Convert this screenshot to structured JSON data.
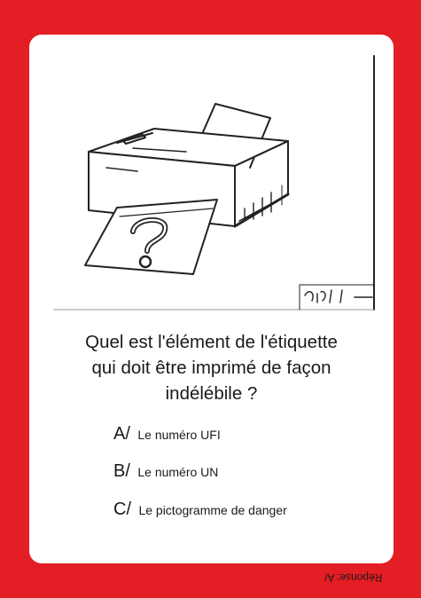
{
  "card": {
    "illustration": {
      "icon": "printer-question-icon",
      "signature": "ลุงวิ ๆ"
    },
    "question_lines": [
      "Quel est l'élément de l'étiquette",
      "qui doit être imprimé de façon",
      "indélébile ?"
    ],
    "answers": [
      {
        "letter": "A/",
        "text": "Le numéro UFI"
      },
      {
        "letter": "B/",
        "text": "Le numéro UN"
      },
      {
        "letter": "C/",
        "text": "Le pictogramme de danger"
      }
    ],
    "answer_key": "Réponse: A/"
  },
  "colors": {
    "background": "#e31e24",
    "card": "#ffffff",
    "text": "#1a1a1a"
  }
}
